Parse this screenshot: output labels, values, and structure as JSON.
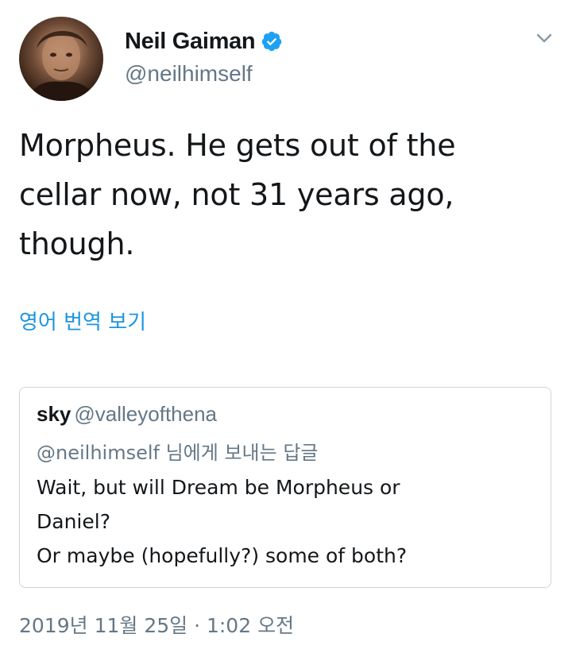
{
  "author": {
    "display_name": "Neil Gaiman",
    "handle": "@neilhimself",
    "verified": true,
    "avatar_icon": "profile-photo"
  },
  "menu": {
    "icon": "chevron-down-icon"
  },
  "tweet": {
    "lines": [
      "Morpheus. He gets out of the",
      "cellar now, not 31 years ago,",
      "though."
    ],
    "translate_label": "영어 번역 보기",
    "timestamp": "2019년 11월 25일 · 1:02 오전"
  },
  "quoted_tweet": {
    "name": "sky",
    "handle": "@valleyofthena",
    "reply_context": "@neilhimself 님에게 보내는 답글",
    "lines": [
      "Wait, but will Dream be Morpheus or",
      "Daniel?",
      "Or maybe (hopefully?) some of both?"
    ]
  },
  "colors": {
    "link_blue": "#1b95e0",
    "verified_blue": "#1da1f2",
    "secondary_text": "#657786",
    "primary_text": "#14171a",
    "border": "#ccd6dd"
  }
}
